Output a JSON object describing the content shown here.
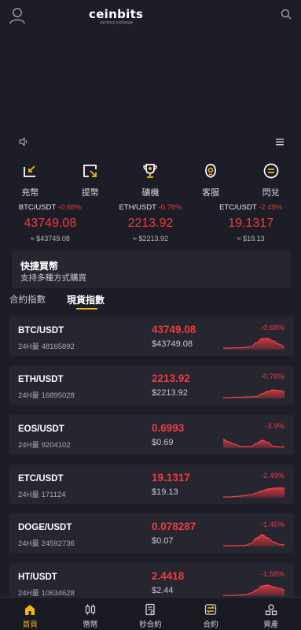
{
  "header": {
    "logo_text": "ceinbits",
    "logo_sub": "currency exchange",
    "user_icon": "user-icon",
    "search_icon": "search-icon"
  },
  "notice": {
    "speaker_icon": "speaker-icon",
    "menu_icon": "menu-icon"
  },
  "quick_actions": [
    {
      "label": "充幣",
      "icon": "deposit-icon"
    },
    {
      "label": "提幣",
      "icon": "withdraw-icon"
    },
    {
      "label": "礦機",
      "icon": "trophy-icon"
    },
    {
      "label": "客服",
      "icon": "support-icon"
    },
    {
      "label": "閃兌",
      "icon": "exchange-icon"
    }
  ],
  "tickers": [
    {
      "pair": "BTC/USDT",
      "change": "-0.68%",
      "price": "43749.08",
      "usd": "≈ $43749.08"
    },
    {
      "pair": "ETH/USDT",
      "change": "-0.78%",
      "price": "2213.92",
      "usd": "≈ $2213.92"
    },
    {
      "pair": "ETC/USDT",
      "change": "-2.49%",
      "price": "19.1317",
      "usd": "≈ $19.13"
    }
  ],
  "buy_card": {
    "title": "快捷買幣",
    "subtitle": "支持多種方式購買"
  },
  "tabs": [
    {
      "label": "合約指數",
      "active": false
    },
    {
      "label": "現貨指數",
      "active": true
    }
  ],
  "market_list": [
    {
      "pair": "BTC/USDT",
      "volume": "24H量 48165892",
      "price": "43749.08",
      "usd": "$43749.08",
      "change": "-0.68%",
      "spark": [
        0.1,
        0.1,
        0.12,
        0.12,
        0.15,
        0.2,
        0.45,
        0.7,
        0.72,
        0.55,
        0.35,
        0.15
      ]
    },
    {
      "pair": "ETH/USDT",
      "volume": "24H量 16895028",
      "price": "2213.92",
      "usd": "$2213.92",
      "change": "-0.78%",
      "spark": [
        0.05,
        0.05,
        0.08,
        0.08,
        0.1,
        0.1,
        0.12,
        0.3,
        0.45,
        0.55,
        0.5,
        0.45
      ]
    },
    {
      "pair": "EOS/USDT",
      "volume": "24H量 9204102",
      "price": "0.6993",
      "usd": "$0.69",
      "change": "-3.9%",
      "spark": [
        0.55,
        0.4,
        0.25,
        0.12,
        0.1,
        0.1,
        0.3,
        0.5,
        0.35,
        0.12,
        0.08,
        0.08
      ]
    },
    {
      "pair": "ETC/USDT",
      "volume": "24H量 171124",
      "price": "19.1317",
      "usd": "$19.13",
      "change": "-2.49%",
      "spark": [
        0.05,
        0.05,
        0.08,
        0.1,
        0.15,
        0.2,
        0.3,
        0.45,
        0.55,
        0.6,
        0.62,
        0.62
      ]
    },
    {
      "pair": "DOGE/USDT",
      "volume": "24H量 24592736",
      "price": "0.078287",
      "usd": "$0.07",
      "change": "-1.45%",
      "spark": [
        0.05,
        0.05,
        0.05,
        0.06,
        0.08,
        0.2,
        0.55,
        0.75,
        0.55,
        0.3,
        0.15,
        0.1
      ]
    },
    {
      "pair": "HT/USDT",
      "volume": "24H量 10634628",
      "price": "2.4418",
      "usd": "$2.44",
      "change": "-1.58%",
      "spark": [
        0.05,
        0.05,
        0.05,
        0.08,
        0.1,
        0.2,
        0.4,
        0.65,
        0.7,
        0.6,
        0.5,
        0.4
      ]
    }
  ],
  "colors": {
    "accent": "#f0b90b",
    "down": "#ee3b40",
    "card": "#262631",
    "bg": "#1d1d27"
  },
  "bottom_nav": [
    {
      "label": "首頁",
      "icon": "home-icon",
      "active": true
    },
    {
      "label": "幣幣",
      "icon": "coins-icon",
      "active": false
    },
    {
      "label": "秒合約",
      "icon": "document-icon",
      "active": false
    },
    {
      "label": "合約",
      "icon": "swap-icon",
      "active": false
    },
    {
      "label": "資產",
      "icon": "assets-icon",
      "active": false
    }
  ]
}
